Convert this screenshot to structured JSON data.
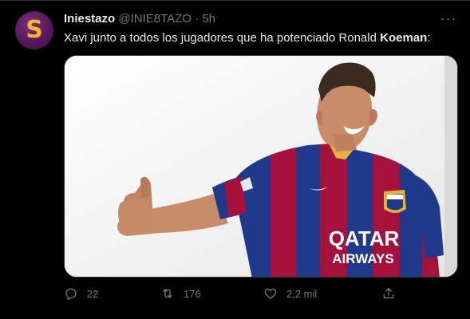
{
  "tweet": {
    "avatar_letter": "S",
    "display_name": "Iniestazo",
    "handle": "@INIE8TAZO",
    "separator": " · ",
    "time": "5h",
    "more_icon": "ellipsis-icon",
    "text_before": "Xavi junto a todos los jugadores que ha potenciado Ronald ",
    "text_bold": "Koeman",
    "text_after": ":",
    "media": {
      "shirt_sponsor_line1": "QATAR",
      "shirt_sponsor_line2": "AIRWAYS",
      "colors": {
        "blue": "#1f3a8a",
        "garnet": "#a5113a",
        "gold": "#e0b53a"
      }
    },
    "actions": {
      "reply_icon": "reply-icon",
      "reply_count": "22",
      "retweet_icon": "retweet-icon",
      "retweet_count": "176",
      "like_icon": "heart-icon",
      "like_count": "2,2 mil",
      "share_icon": "share-icon"
    }
  }
}
